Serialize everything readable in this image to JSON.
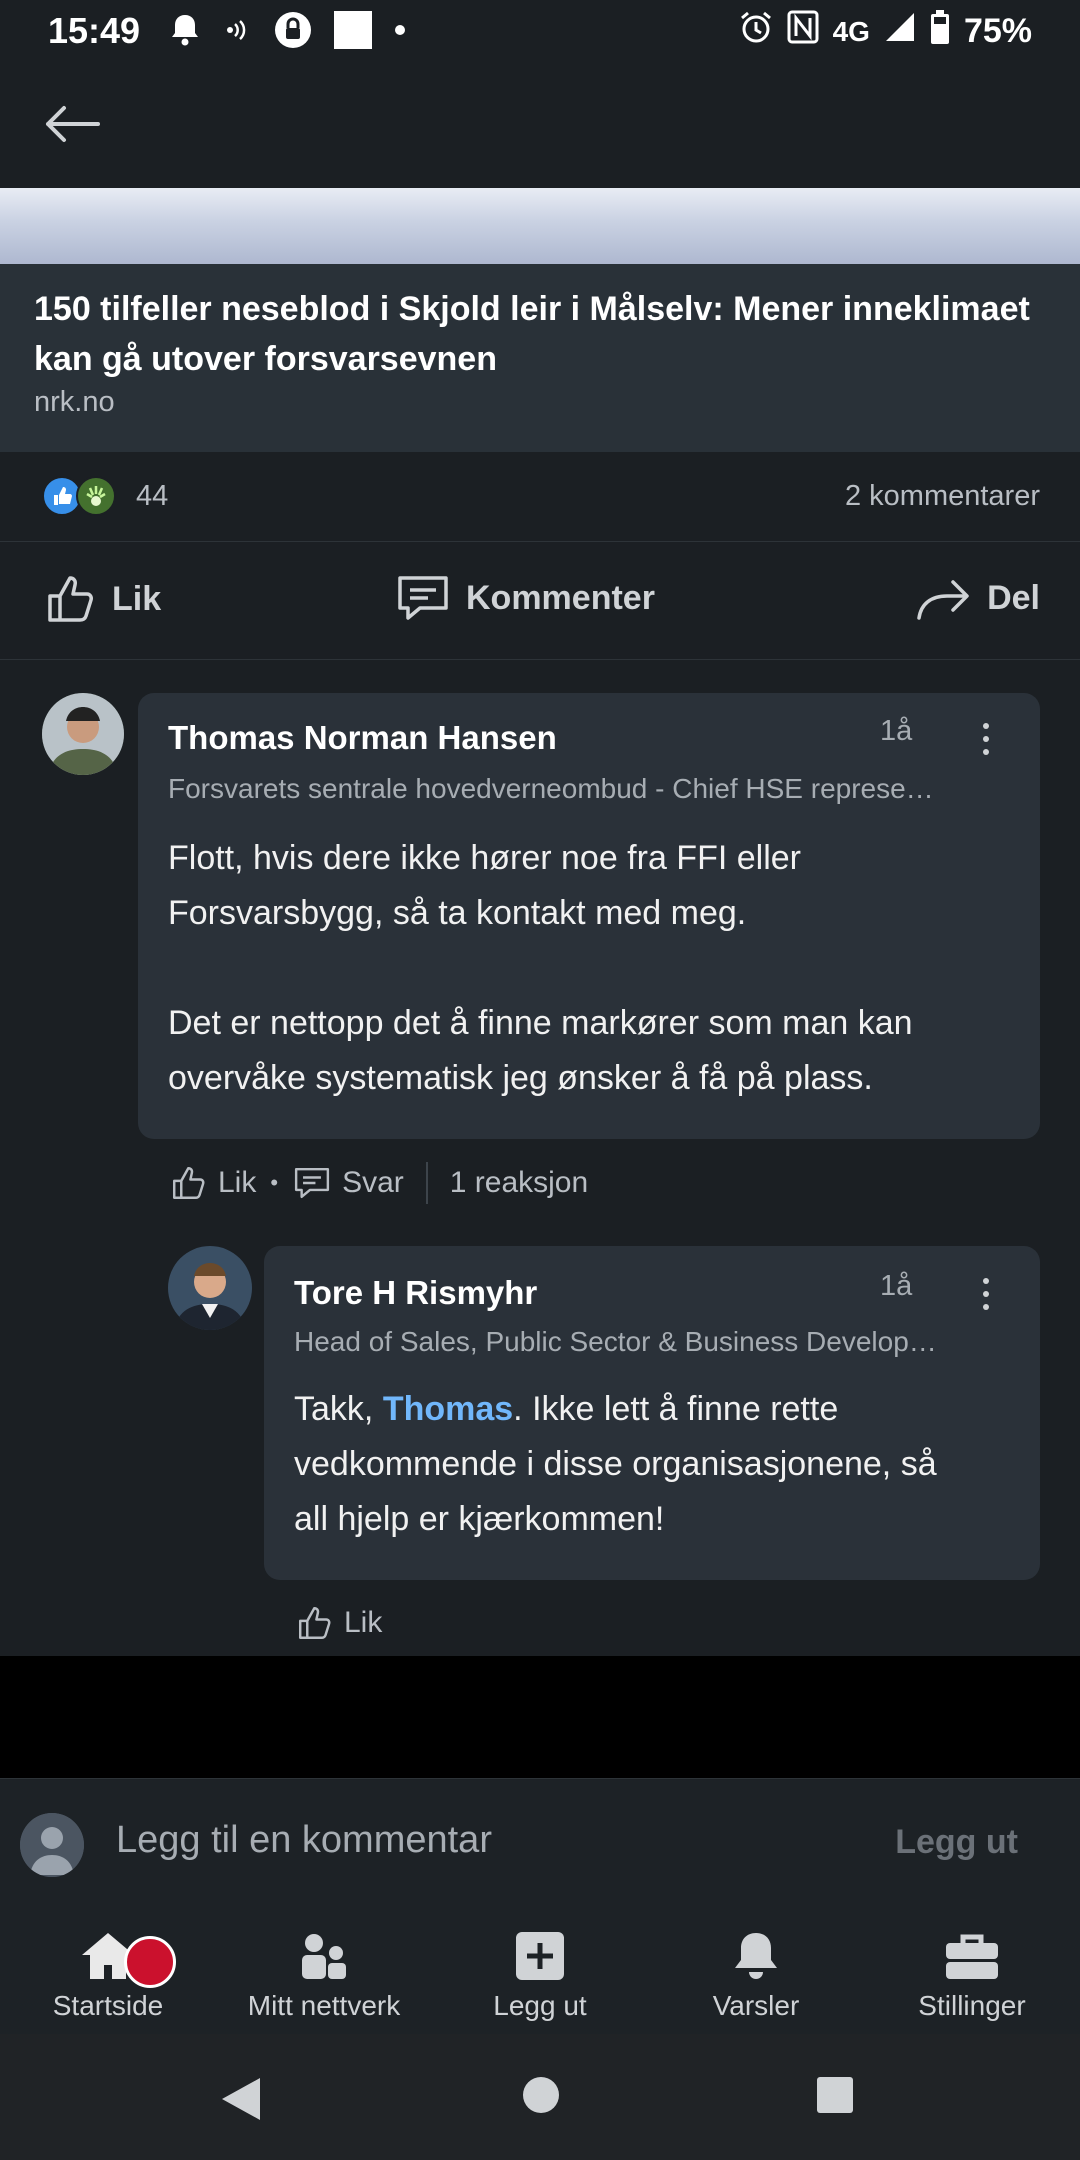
{
  "status_bar": {
    "time": "15:49",
    "network": "4G",
    "battery": "75%",
    "icons": [
      "bell-icon",
      "nfc-icon",
      "vpn-lock-icon",
      "square-icon",
      "dot-icon",
      "alarm-icon",
      "n-icon",
      "signal-icon",
      "battery-icon"
    ]
  },
  "article": {
    "title": "150 tilfeller neseblod i Skjold leir i Målselv: Mener inneklimaet kan gå utover forsvarsevnen",
    "source": "nrk.no"
  },
  "social": {
    "reaction_count": "44",
    "comment_count": "2 kommentarer"
  },
  "actions": {
    "like": "Lik",
    "comment": "Kommenter",
    "share": "Del"
  },
  "comments": [
    {
      "name": "Thomas Norman Hansen",
      "headline": "Forsvarets sentrale hovedverneombud - Chief HSE represe…",
      "time": "1å",
      "body_line1": "Flott, hvis dere ikke hører noe fra FFI eller",
      "body_line2": "Forsvarsbygg, så ta kontakt med meg.",
      "body_line3": "Det er nettopp det å finne markører som man kan",
      "body_line4": "overvåke systematisk jeg ønsker å få på plass.",
      "like": "Lik",
      "reply": "Svar",
      "reactions": "1 reaksjon"
    },
    {
      "name": "Tore H Rismyhr",
      "headline": "Head of Sales, Public Sector & Business Develop…",
      "time": "1å",
      "body_prefix": "Takk, ",
      "mention": "Thomas",
      "body_suffix": ". Ikke lett å finne rette",
      "body_line2": "vedkommende i disse organisasjonene, så",
      "body_line3": "all hjelp er kjærkommen!",
      "like": "Lik"
    }
  ],
  "composer": {
    "placeholder": "Legg til en kommentar",
    "post": "Legg ut"
  },
  "bottom_nav": [
    {
      "label": "Startside",
      "icon": "home-icon"
    },
    {
      "label": "Mitt nettverk",
      "icon": "network-icon"
    },
    {
      "label": "Legg ut",
      "icon": "add-post-icon"
    },
    {
      "label": "Varsler",
      "icon": "bell-icon"
    },
    {
      "label": "Stillinger",
      "icon": "briefcase-icon"
    }
  ],
  "colors": {
    "background": "#1b1f23",
    "card": "#293138",
    "mention": "#71b7fb",
    "badge": "#cb112d"
  }
}
